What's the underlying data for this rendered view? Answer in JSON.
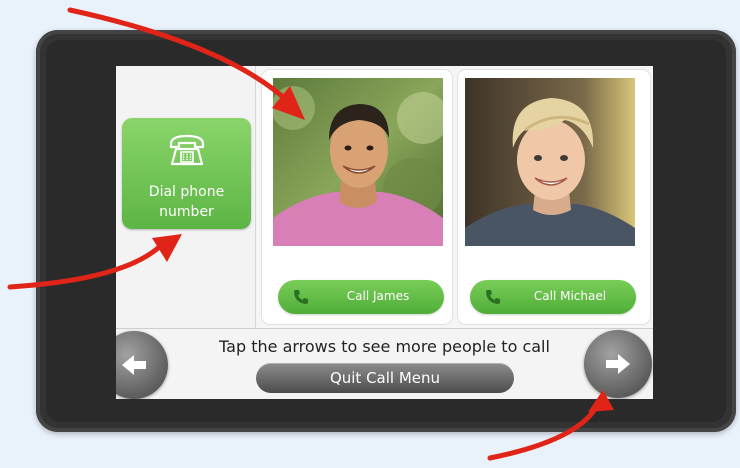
{
  "screen": {
    "dial_button": {
      "label": "Dial phone number",
      "icon": "telephone-icon"
    },
    "contacts": [
      {
        "call_label": "Call James",
        "icon": "phone-handset-icon"
      },
      {
        "call_label": "Call Michael",
        "icon": "phone-handset-icon"
      }
    ],
    "hint": "Tap the arrows to see more people to call",
    "quit_label": "Quit Call Menu",
    "nav": {
      "prev_icon": "arrow-left-icon",
      "next_icon": "arrow-right-icon"
    }
  },
  "colors": {
    "background": "#e9f1fb",
    "device_frame": "#333334",
    "accent_green": "#5cb544",
    "annotation_red": "#e02418",
    "button_gray": "#5e5e5e"
  }
}
